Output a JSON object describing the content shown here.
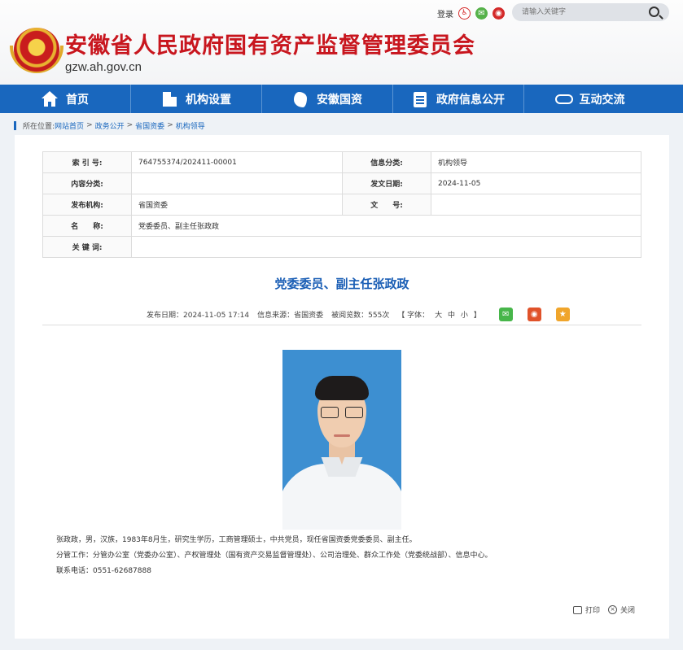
{
  "header": {
    "site_title": "安徽省人民政府国有资产监督管理委员会",
    "site_domain": "gzw.ah.gov.cn",
    "login_label": "登录",
    "search_placeholder": "请输入关键字"
  },
  "nav": {
    "items": [
      {
        "label": "首页",
        "icon": "home-icon"
      },
      {
        "label": "机构设置",
        "icon": "building-icon"
      },
      {
        "label": "安徽国资",
        "icon": "map-icon"
      },
      {
        "label": "政府信息公开",
        "icon": "document-icon"
      },
      {
        "label": "互动交流",
        "icon": "handshake-icon"
      }
    ]
  },
  "breadcrumb": {
    "prefix": "所在位置:",
    "items": [
      "网站首页",
      "政务公开",
      "省国资委",
      "机构领导"
    ]
  },
  "meta": {
    "index_label": "索 引 号:",
    "index_value": "764755374/202411-00001",
    "category_label": "信息分类:",
    "category_value": "机构领导",
    "content_cat_label": "内容分类:",
    "content_cat_value": "",
    "date_label": "发文日期:",
    "date_value": "2024-11-05",
    "publisher_label": "发布机构:",
    "publisher_value": "省国资委",
    "docno_label": "文　　号:",
    "docno_value": "",
    "name_label": "名　　称:",
    "name_value": "党委委员、副主任张政政",
    "keywords_label": "关 键 词:",
    "keywords_value": ""
  },
  "article": {
    "title": "党委委员、副主任张政政",
    "publish_date": "发布日期：2024-11-05 17:14",
    "source": "信息来源：省国资委",
    "views": "被阅览数：555次",
    "font_prefix": "【 字体：",
    "font_large": "大",
    "font_medium": "中",
    "font_small": "小",
    "font_suffix": "】",
    "bio": "张政政，男，汉族，1983年8月生，研究生学历，工商管理硕士，中共党员，现任省国资委党委委员、副主任。",
    "duties": "分管工作：分管办公室（党委办公室）、产权管理处（国有资产交易监督管理处）、公司治理处、群众工作处（党委统战部）、信息中心。",
    "phone": "联系电话：0551-62687888"
  },
  "actions": {
    "print": "打印",
    "close": "关闭"
  }
}
